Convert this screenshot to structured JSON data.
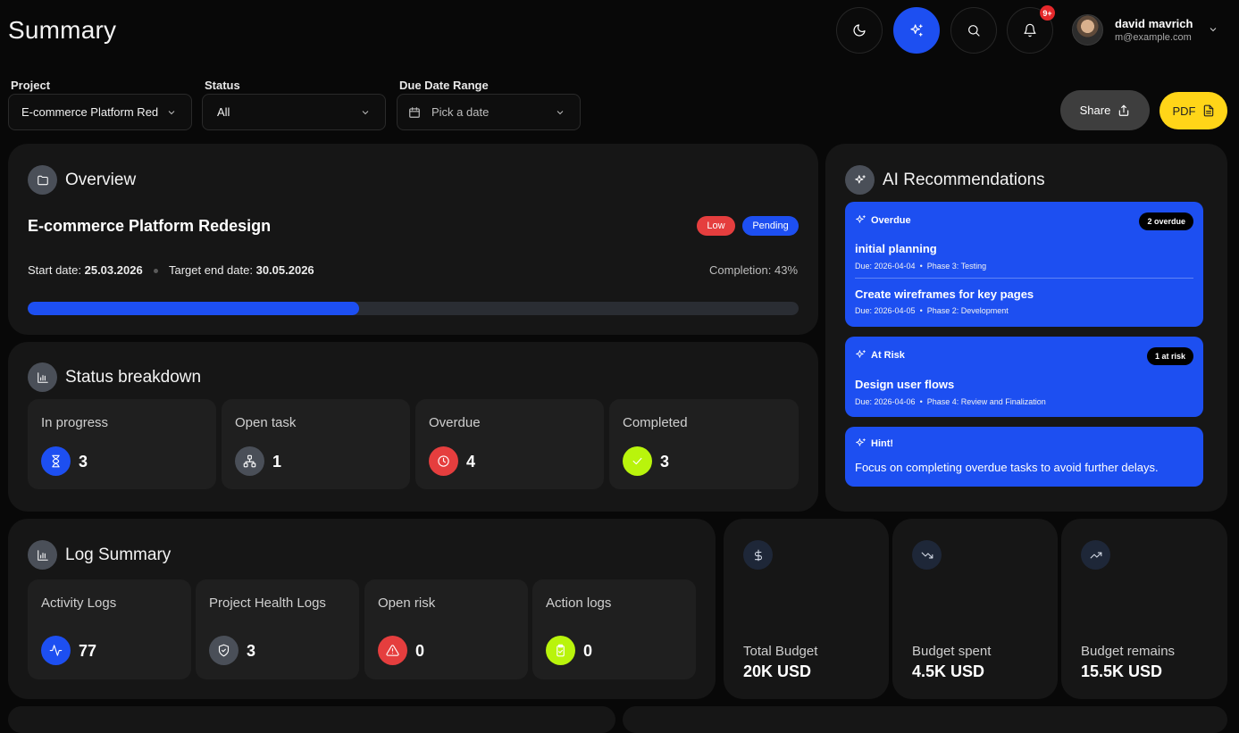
{
  "header": {
    "title": "Summary",
    "notification_count": "9+",
    "user": {
      "name": "david mavrich",
      "email": "m@example.com"
    }
  },
  "filters": {
    "project": {
      "label": "Project",
      "value": "E-commerce Platform Red"
    },
    "status": {
      "label": "Status",
      "value": "All"
    },
    "due_date": {
      "label": "Due Date Range",
      "placeholder": "Pick a date"
    }
  },
  "actions": {
    "share_label": "Share",
    "pdf_label": "PDF"
  },
  "overview": {
    "title": "Overview",
    "project_name": "E-commerce Platform Redesign",
    "priority": "Low",
    "state": "Pending",
    "start_label": "Start date:",
    "start_date": "25.03.2026",
    "target_label": "Target end date:",
    "target_date": "30.05.2026",
    "completion_text": "Completion: 43%",
    "completion_fraction": 0.43
  },
  "status_breakdown": {
    "title": "Status breakdown",
    "items": [
      {
        "label": "In progress",
        "value": "3",
        "icon": "hourglass-icon"
      },
      {
        "label": "Open task",
        "value": "1",
        "icon": "network-icon"
      },
      {
        "label": "Overdue",
        "value": "4",
        "icon": "clock-icon"
      },
      {
        "label": "Completed",
        "value": "3",
        "icon": "check-icon"
      }
    ]
  },
  "ai": {
    "title": "AI Recommendations",
    "overdue": {
      "heading": "Overdue",
      "badge": "2 overdue",
      "tasks": [
        {
          "name": "initial planning",
          "due": "Due: 2026-04-04",
          "phase": "Phase 3: Testing"
        },
        {
          "name": "Create wireframes for key pages",
          "due": "Due: 2026-04-05",
          "phase": "Phase 2: Development"
        }
      ]
    },
    "at_risk": {
      "heading": "At Risk",
      "badge": "1 at risk",
      "task": {
        "name": "Design user flows",
        "due": "Due: 2026-04-06",
        "phase": "Phase 4: Review and Finalization"
      }
    },
    "hint": {
      "heading": "Hint!",
      "text": "Focus on completing overdue tasks to avoid further delays."
    }
  },
  "log_summary": {
    "title": "Log Summary",
    "items": [
      {
        "label": "Activity Logs",
        "value": "77",
        "icon": "activity-icon"
      },
      {
        "label": "Project Health Logs",
        "value": "3",
        "icon": "shield-icon"
      },
      {
        "label": "Open risk",
        "value": "0",
        "icon": "warning-icon"
      },
      {
        "label": "Action logs",
        "value": "0",
        "icon": "clipboard-icon"
      }
    ]
  },
  "budget": [
    {
      "label": "Total Budget",
      "value": "20K USD",
      "icon": "dollar-icon"
    },
    {
      "label": "Budget spent",
      "value": "4.5K USD",
      "icon": "trend-down-icon"
    },
    {
      "label": "Budget remains",
      "value": "15.5K USD",
      "icon": "trend-up-icon"
    }
  ],
  "colors": {
    "accent": "#1d4ff1",
    "danger": "#e53e3e",
    "success": "#b9f40c",
    "neutral": "#4a4f58",
    "pdf": "#ffd518"
  }
}
